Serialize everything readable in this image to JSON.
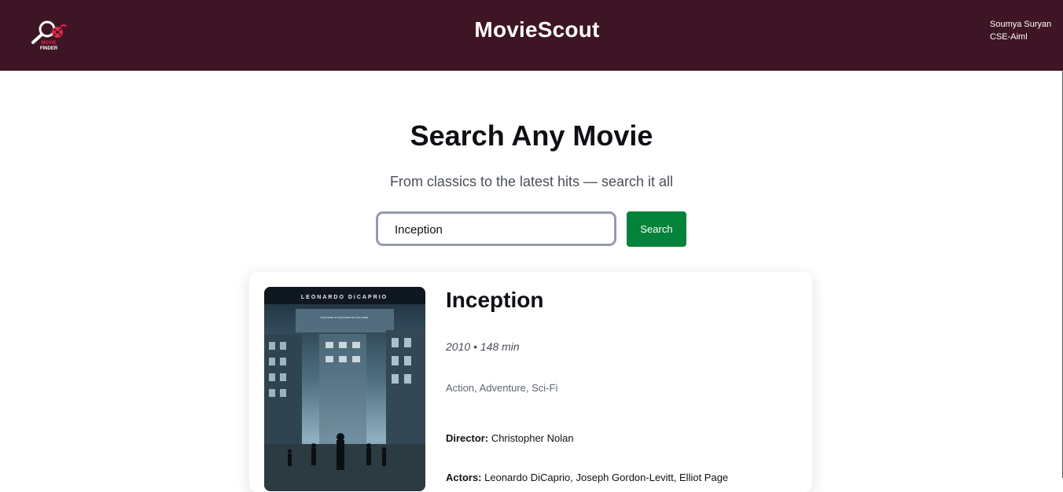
{
  "header": {
    "logo_line1": "MOVIE",
    "logo_line2": "FINDER",
    "title": "MovieScout",
    "user_name": "Soumya Suryan",
    "user_dept": "CSE-Aiml",
    "bg_color": "#3e1525"
  },
  "hero": {
    "title": "Search Any Movie",
    "subtitle": "From classics to the latest hits — search it all"
  },
  "search": {
    "value": "Inception",
    "button_label": "Search",
    "button_color": "#04823a"
  },
  "result": {
    "poster_top_text": "LEONARDO DiCAPRIO",
    "poster_tagline": "YOUR MIND IS THE SCENE OF THE CRIME.",
    "title": "Inception",
    "meta": "2010 • 148 min",
    "genre": "Action, Adventure, Sci-Fi",
    "director_label": "Director:",
    "director": "Christopher Nolan",
    "actors_label": "Actors:",
    "actors": "Leonardo DiCaprio, Joseph Gordon-Levitt, Elliot Page"
  }
}
